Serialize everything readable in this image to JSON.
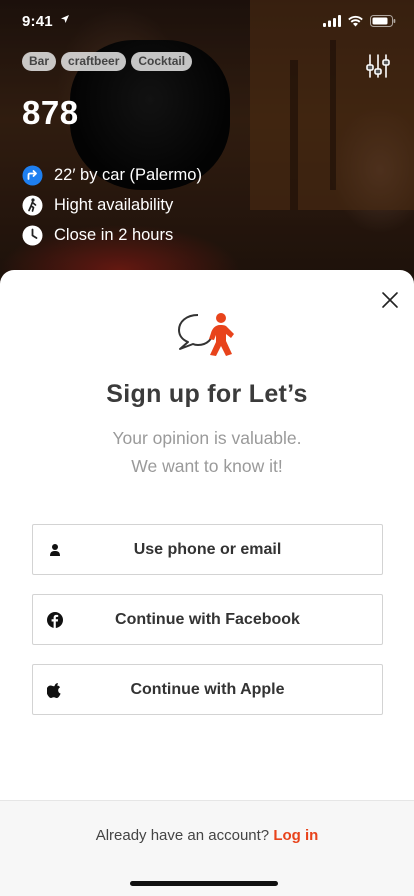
{
  "status_bar": {
    "time": "9:41",
    "location_icon": "location-arrow-icon",
    "signal_icon": "cellular-signal-icon",
    "wifi_icon": "wifi-icon",
    "battery_icon": "battery-icon"
  },
  "venue": {
    "tags": [
      "Bar",
      "craftbeer",
      "Cocktail"
    ],
    "price": "878",
    "info": [
      {
        "icon": "directions-icon",
        "text": "22′ by car (Palermo)"
      },
      {
        "icon": "crowd-walking-icon",
        "text": "Hight availability"
      },
      {
        "icon": "clock-icon",
        "text": "Close in 2 hours"
      }
    ],
    "filter_icon": "sliders-icon"
  },
  "signup": {
    "close_icon": "close-icon",
    "logo_icon": "chat-person-logo-icon",
    "title": "Sign up for Let’s",
    "subtitle_line1": "Your opinion is valuable.",
    "subtitle_line2": "We want to know it!",
    "buttons": [
      {
        "icon": "person-icon",
        "label": "Use phone or email"
      },
      {
        "icon": "facebook-icon",
        "label": "Continue with Facebook"
      },
      {
        "icon": "apple-icon",
        "label": "Continue with Apple"
      }
    ],
    "footer_text": "Already have an account?",
    "footer_link": "Log in"
  },
  "colors": {
    "accent": "#e8431b",
    "title_text": "#3b3b3b",
    "subtitle_text": "#9a9a9a",
    "directions_blue": "#1e7ff0"
  }
}
